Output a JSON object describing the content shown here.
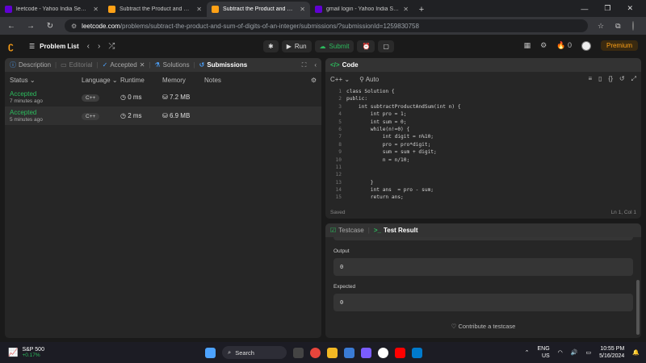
{
  "browser": {
    "tabs": [
      {
        "title": "leetcode - Yahoo India Search R",
        "favicon_color": "#6001d2",
        "active": false
      },
      {
        "title": "Subtract the Product and Sum",
        "favicon_color": "#ffa116",
        "active": false
      },
      {
        "title": "Subtract the Product and Sum",
        "favicon_color": "#ffa116",
        "active": true
      },
      {
        "title": "gmail login - Yahoo India Searc",
        "favicon_color": "#6001d2",
        "active": false
      }
    ],
    "url_host": "leetcode.com",
    "url_path": "/problems/subtract-the-product-and-sum-of-digits-of-an-integer/submissions/?submissionId=1259830758"
  },
  "header": {
    "problem_list": "Problem List",
    "run_label": "Run",
    "submit_label": "Submit",
    "streak": "0",
    "premium_label": "Premium"
  },
  "left_panel": {
    "tabs": [
      {
        "label": "Description"
      },
      {
        "label": "Editorial"
      },
      {
        "label": "Accepted"
      },
      {
        "label": "Solutions"
      },
      {
        "label": "Submissions"
      }
    ],
    "columns": [
      "Status",
      "Language",
      "Runtime",
      "Memory",
      "Notes"
    ],
    "rows": [
      {
        "status": "Accepted",
        "time": "7 minutes ago",
        "language": "C++",
        "runtime": "0 ms",
        "memory": "7.2 MB"
      },
      {
        "status": "Accepted",
        "time": "5 minutes ago",
        "language": "C++",
        "runtime": "2 ms",
        "memory": "6.9 MB"
      }
    ]
  },
  "code_panel": {
    "title": "Code",
    "language": "C++",
    "mode": "Auto",
    "lines": [
      {
        "n": "1",
        "text": "class Solution {"
      },
      {
        "n": "2",
        "text": "public:"
      },
      {
        "n": "3",
        "text": "    int subtractProductAndSum(int n) {"
      },
      {
        "n": "4",
        "text": "        int pro = 1;"
      },
      {
        "n": "5",
        "text": "        int sum = 0;"
      },
      {
        "n": "6",
        "text": "        while(n!=0) {"
      },
      {
        "n": "7",
        "text": "            int digit = n%10;"
      },
      {
        "n": "8",
        "text": "            pro = pro*digit;"
      },
      {
        "n": "9",
        "text": "            sum = sum + digit;"
      },
      {
        "n": "10",
        "text": "            n = n/10;"
      },
      {
        "n": "11",
        "text": ""
      },
      {
        "n": "12",
        "text": ""
      },
      {
        "n": "13",
        "text": "        }"
      },
      {
        "n": "14",
        "text": "        int ans  = pro - sum;"
      },
      {
        "n": "15",
        "text": "        return ans;"
      }
    ],
    "saved": "Saved",
    "cursor": "Ln 1, Col 1"
  },
  "test_panel": {
    "tab1": "Testcase",
    "tab2": "Test Result",
    "output_label": "Output",
    "output_value": "0",
    "expected_label": "Expected",
    "expected_value": "0",
    "contribute": "Contribute a testcase"
  },
  "taskbar": {
    "stock_name": "S&P 500",
    "stock_change": "+0.17%",
    "search": "Search",
    "lang1": "ENG",
    "lang2": "US",
    "time": "10:55 PM",
    "date": "5/16/2024"
  }
}
